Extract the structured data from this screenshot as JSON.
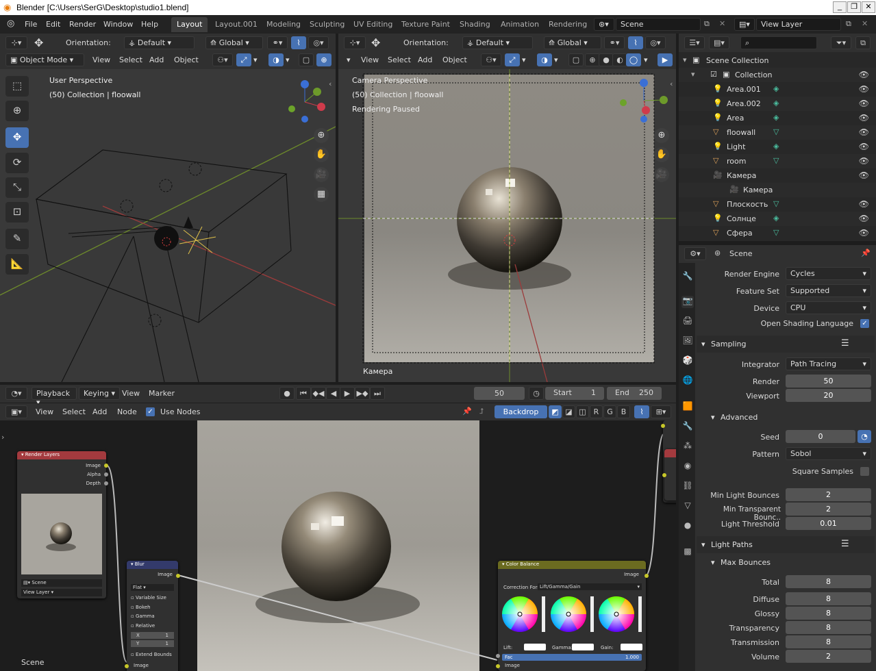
{
  "window": {
    "title": "Blender [C:\\Users\\SerG\\Desktop\\studio1.blend]",
    "btn_min": "_",
    "btn_max": "❐",
    "btn_close": "✕"
  },
  "menu": [
    "File",
    "Edit",
    "Render",
    "Window",
    "Help"
  ],
  "workspaces": [
    "Layout",
    "Layout.001",
    "Modeling",
    "Sculpting",
    "UV Editing",
    "Texture Paint",
    "Shading",
    "Animation",
    "Rendering"
  ],
  "active_workspace": "Layout",
  "scene_name": "Scene",
  "view_layer": "View Layer",
  "vp1": {
    "orientation_label": "Orientation:",
    "orientation": "Default",
    "transform": "Global",
    "mode": "Object Mode",
    "menus": [
      "View",
      "Select",
      "Add",
      "Object"
    ],
    "overlay_line1": "User Perspective",
    "overlay_line2": "(50) Collection | floowall"
  },
  "vp2": {
    "orientation_label": "Orientation:",
    "orientation": "Default",
    "transform": "Global",
    "menus": [
      "View",
      "Select",
      "Add",
      "Object"
    ],
    "overlay_line1": "Camera Perspective",
    "overlay_line2": "(50) Collection | floowall",
    "overlay_line3": "Rendering Paused",
    "camera_label": "Камера"
  },
  "outliner": {
    "search_placeholder": "",
    "items": [
      {
        "label": "Scene Collection",
        "icon": "collection-icon",
        "indent": 0
      },
      {
        "label": "Collection",
        "icon": "collection-icon",
        "indent": 1
      },
      {
        "label": "Area.001",
        "icon": "light-icon",
        "indent": 2
      },
      {
        "label": "Area.002",
        "icon": "light-icon",
        "indent": 2
      },
      {
        "label": "Area",
        "icon": "light-icon",
        "indent": 2
      },
      {
        "label": "floowall",
        "icon": "mesh-icon",
        "indent": 2
      },
      {
        "label": "Light",
        "icon": "light-icon",
        "indent": 2
      },
      {
        "label": "room",
        "icon": "mesh-icon",
        "indent": 2
      },
      {
        "label": "Камера",
        "icon": "camera-icon",
        "indent": 2
      },
      {
        "label": "Камера",
        "icon": "camera-data-icon",
        "indent": 3
      },
      {
        "label": "Плоскость",
        "icon": "mesh-icon",
        "indent": 2
      },
      {
        "label": "Солнце",
        "icon": "light-icon",
        "indent": 2
      },
      {
        "label": "Сфера",
        "icon": "mesh-icon",
        "indent": 2
      }
    ]
  },
  "properties": {
    "context": "Scene",
    "render_engine_label": "Render Engine",
    "render_engine": "Cycles",
    "feature_set_label": "Feature Set",
    "feature_set": "Supported",
    "device_label": "Device",
    "device": "CPU",
    "osl_label": "Open Shading Language",
    "sampling": "Sampling",
    "integrator_label": "Integrator",
    "integrator": "Path Tracing",
    "render_label": "Render",
    "render": "50",
    "viewport_label": "Viewport",
    "viewport": "20",
    "advanced": "Advanced",
    "seed_label": "Seed",
    "seed": "0",
    "pattern_label": "Pattern",
    "pattern": "Sobol",
    "square_samples_label": "Square Samples",
    "min_light_bounces_label": "Min Light Bounces",
    "min_light_bounces": "2",
    "min_transparent_label": "Min Transparent Bounc..",
    "min_transparent": "2",
    "light_threshold_label": "Light Threshold",
    "light_threshold": "0.01",
    "light_paths": "Light Paths",
    "max_bounces": "Max Bounces",
    "total_label": "Total",
    "total": "8",
    "diffuse_label": "Diffuse",
    "diffuse": "8",
    "glossy_label": "Glossy",
    "glossy": "8",
    "transparency_label": "Transparency",
    "transparency": "8",
    "transmission_label": "Transmission",
    "transmission": "8",
    "volume_label": "Volume",
    "volume": "2"
  },
  "timeline": {
    "menus": [
      "Playback",
      "Keying",
      "View",
      "Marker"
    ],
    "current_frame": "50",
    "start_label": "Start",
    "start": "1",
    "end_label": "End",
    "end": "250"
  },
  "node_editor": {
    "menus": [
      "View",
      "Select",
      "Add",
      "Node"
    ],
    "use_nodes_label": "Use Nodes",
    "backdrop_label": "Backdrop",
    "channels": [
      "R",
      "G",
      "B"
    ],
    "footer_label": "Scene",
    "render_layers": {
      "title": "Render Layers",
      "outputs": [
        "Image",
        "Alpha",
        "Depth"
      ],
      "scene": "Scene",
      "view_layer": "View Layer"
    },
    "blur": {
      "title": "Blur",
      "output": "Image",
      "type": "Flat",
      "options": [
        "Variable Size",
        "Bokeh",
        "Gamma",
        "Relative"
      ],
      "x_label": "X",
      "x": "1",
      "y_label": "Y",
      "y": "1",
      "extend": "Extend Bounds",
      "input": "Image"
    },
    "color_balance": {
      "title": "Color Balance",
      "output": "Image",
      "correction_label": "Correction Form..",
      "correction": "Lift/Gamma/Gain",
      "lift": "Lift:",
      "gamma": "Gamma:",
      "gain": "Gain:",
      "fac_label": "Fac",
      "fac": "1.000",
      "input": "Image"
    }
  },
  "colors": {
    "accent": "#4772b3",
    "bg": "#1d1d1d",
    "panel": "#303030",
    "node_header_red": "#a33a3e",
    "node_header_blur": "#333a6b",
    "node_header_color": "#6b6b20"
  }
}
